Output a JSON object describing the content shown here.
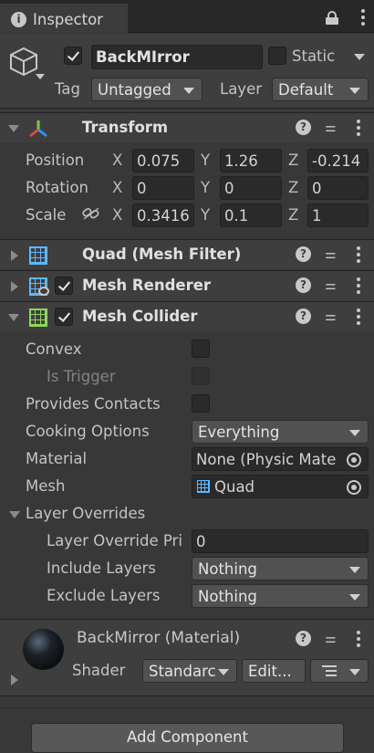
{
  "tab": {
    "title": "Inspector"
  },
  "gameobject": {
    "active": true,
    "name": "BackMIrror",
    "static_label": "Static",
    "static_checked": false,
    "tag_label": "Tag",
    "tag_value": "Untagged",
    "layer_label": "Layer",
    "layer_value": "Default"
  },
  "transform": {
    "title": "Transform",
    "position_label": "Position",
    "rotation_label": "Rotation",
    "scale_label": "Scale",
    "axis_x": "X",
    "axis_y": "Y",
    "axis_z": "Z",
    "position": {
      "x": "0.075",
      "y": "1.26",
      "z": "-0.214"
    },
    "rotation": {
      "x": "0",
      "y": "0",
      "z": "0"
    },
    "scale": {
      "x": "0.3416",
      "y": "0.1",
      "z": "1"
    }
  },
  "mesh_filter": {
    "title": "Quad (Mesh Filter)"
  },
  "mesh_renderer": {
    "title": "Mesh Renderer",
    "enabled": true
  },
  "mesh_collider": {
    "title": "Mesh Collider",
    "enabled": true,
    "convex_label": "Convex",
    "convex": false,
    "is_trigger_label": "Is Trigger",
    "is_trigger": false,
    "provides_contacts_label": "Provides Contacts",
    "provides_contacts": false,
    "cooking_options_label": "Cooking Options",
    "cooking_options_value": "Everything",
    "material_label": "Material",
    "material_value": "None (Physic Mate",
    "mesh_label": "Mesh",
    "mesh_value": "Quad",
    "layer_overrides_label": "Layer Overrides",
    "layer_override_priority_label": "Layer Override Pri",
    "layer_override_priority_value": "0",
    "include_layers_label": "Include Layers",
    "include_layers_value": "Nothing",
    "exclude_layers_label": "Exclude Layers",
    "exclude_layers_value": "Nothing"
  },
  "material": {
    "title": "BackMirror (Material)",
    "shader_label": "Shader",
    "shader_value": "Standarc",
    "edit_label": "Edit..."
  },
  "footer": {
    "add_component_label": "Add Component"
  },
  "colors": {
    "background": "#383838",
    "header": "#3e3e3e",
    "field": "#2a2a2a",
    "dropdown": "#515151",
    "mesh_filter_icon": "#5fb8ff",
    "mesh_collider_icon": "#8fd65b"
  }
}
